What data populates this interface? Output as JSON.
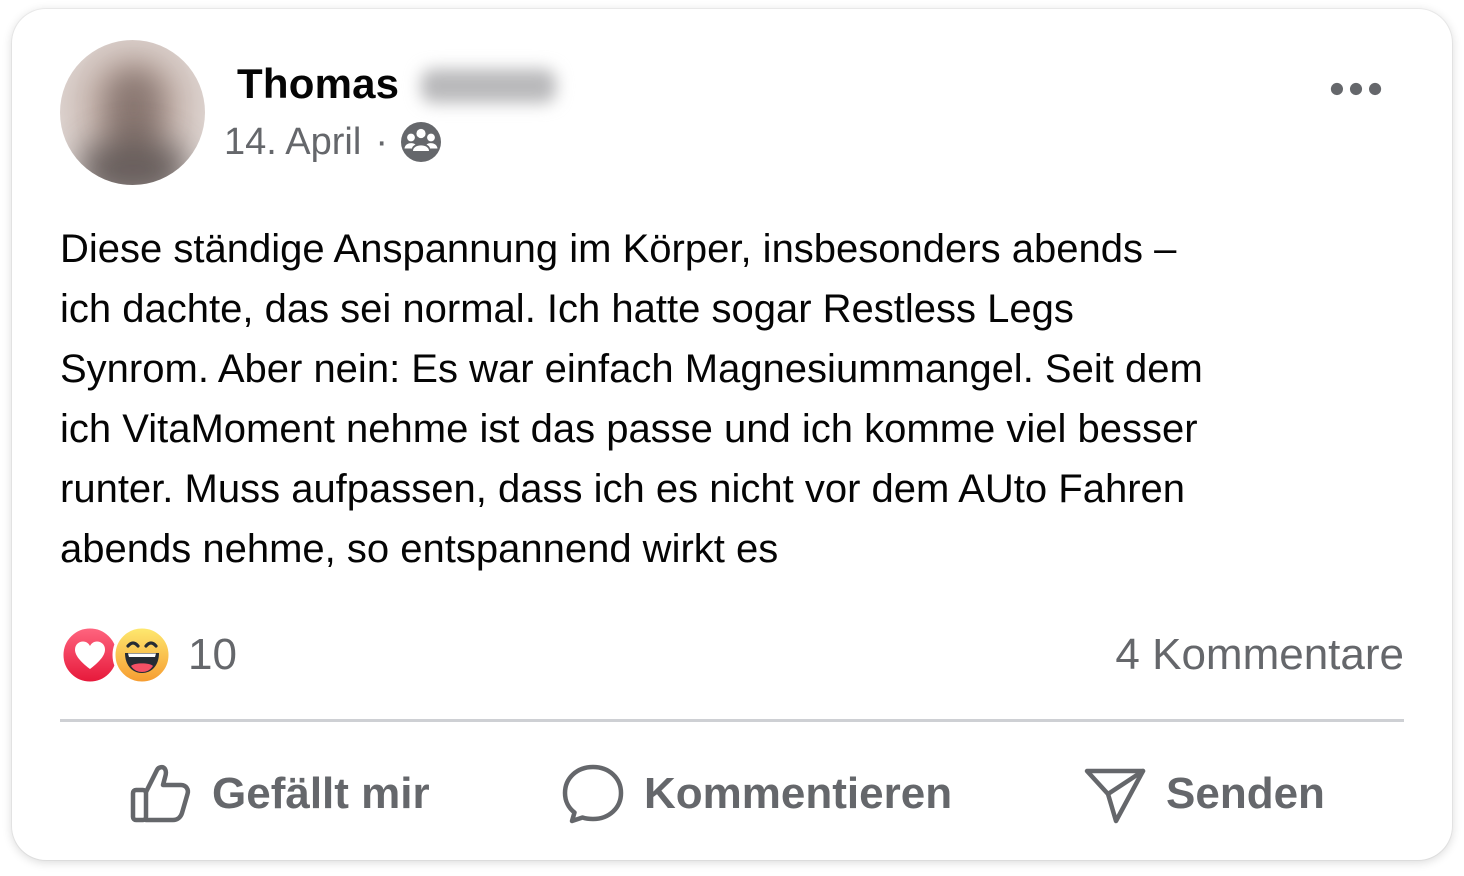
{
  "post": {
    "author": {
      "first_name": "Thomas",
      "avatar_icon": "blurred-profile-photo"
    },
    "date": "14. April",
    "separator": "·",
    "audience_icon": "group-audience-icon",
    "more_icon": "more-options-icon",
    "text_lines": [
      "Diese ständige Anspannung im Körper, insbesonders abends –",
      "ich dachte, das sei normal. Ich hatte sogar Restless Legs",
      "Synrom. Aber nein: Es war einfach Magnesiummangel. Seit dem",
      "ich VitaMoment nehme ist das passe und ich komme viel besser",
      "runter. Muss aufpassen, dass ich es nicht vor dem AUto Fahren",
      "abends nehme, so entspannend wirkt es"
    ]
  },
  "reactions": {
    "icons": [
      "love-reaction-icon",
      "haha-reaction-icon"
    ],
    "count": "10",
    "comments": "4 Kommentare"
  },
  "actions": {
    "like_label": "Gefällt mir",
    "comment_label": "Kommentieren",
    "share_label": "Senden"
  },
  "colors": {
    "primary_text": "#050505",
    "secondary_text": "#65676b",
    "divider": "#ced0d4",
    "love": "#f33e58",
    "haha": "#f7b125"
  }
}
